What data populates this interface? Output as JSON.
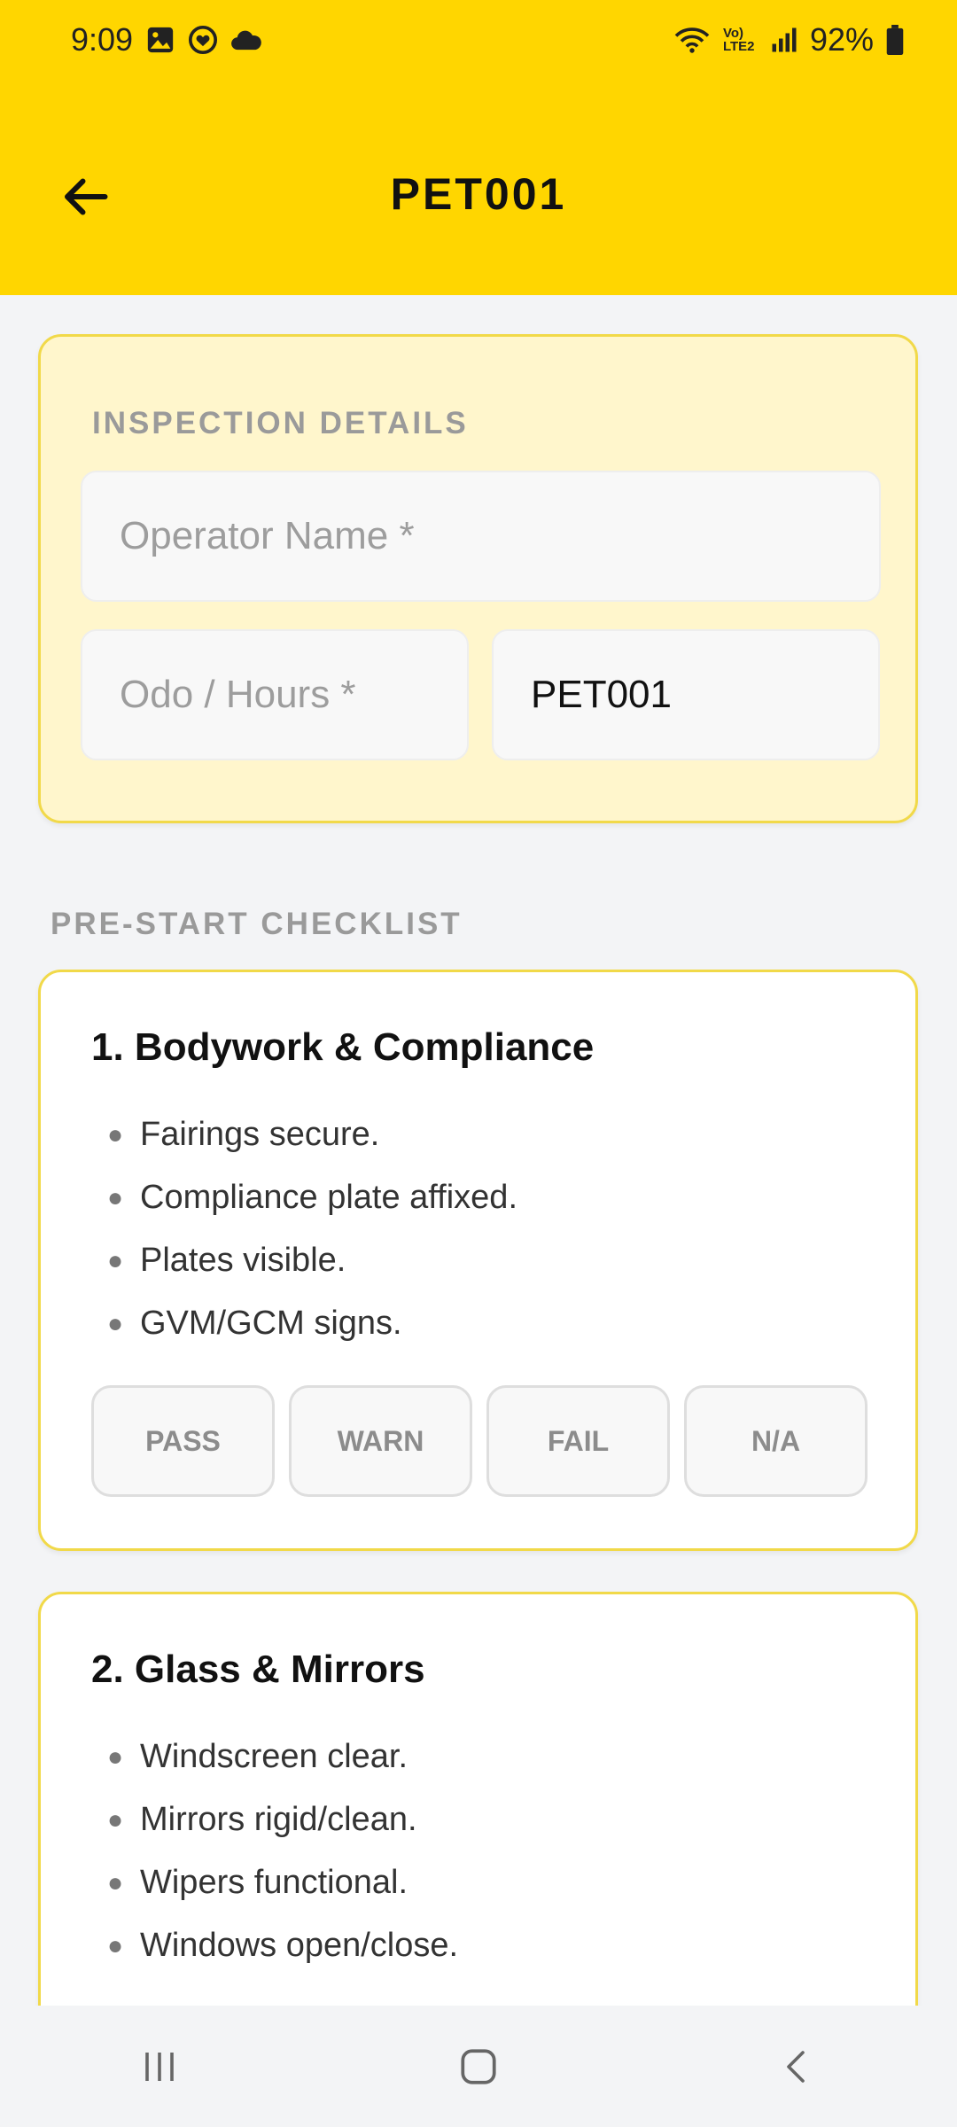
{
  "status_bar": {
    "time": "9:09",
    "battery": "92%",
    "network": "Vo) LTE2",
    "left_icons": [
      "gallery-icon",
      "heart-badge-icon",
      "cloud-icon"
    ],
    "right_icons": [
      "wifi-icon",
      "signal-icon",
      "battery-icon"
    ]
  },
  "app_bar": {
    "title": "PET001",
    "back_icon": "arrow-left-icon",
    "background": "#ffd600"
  },
  "inspection": {
    "section_label": "INSPECTION DETAILS",
    "operator": {
      "placeholder": "Operator Name *",
      "value": ""
    },
    "odo": {
      "placeholder": "Odo / Hours *",
      "value": ""
    },
    "asset": {
      "value": "PET001"
    }
  },
  "checklist": {
    "section_label": "PRE-START CHECKLIST",
    "buttons": [
      "PASS",
      "WARN",
      "FAIL",
      "N/A"
    ],
    "sections": [
      {
        "title": "1. Bodywork & Compliance",
        "items": [
          "Fairings secure.",
          "Compliance plate affixed.",
          "Plates visible.",
          "GVM/GCM signs."
        ]
      },
      {
        "title": "2. Glass & Mirrors",
        "items": [
          "Windscreen clear.",
          "Mirrors rigid/clean.",
          "Wipers functional.",
          "Windows open/close."
        ]
      }
    ]
  },
  "nav_bar": {
    "icons": [
      "recent-apps-icon",
      "home-icon",
      "back-nav-icon"
    ]
  },
  "colors": {
    "accent": "#ffd600",
    "card_border": "#f1d949",
    "details_bg": "#fff6cc"
  }
}
